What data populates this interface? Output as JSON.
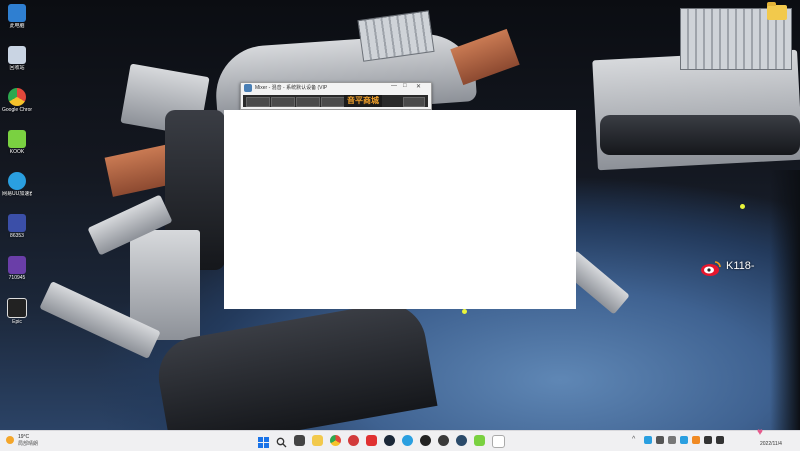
{
  "desktop": {
    "icons": [
      {
        "label": "此电脑",
        "icon": "computer-icon",
        "color": "#2f7fd1"
      },
      {
        "label": "回收站",
        "icon": "recycle-bin-icon",
        "color": "#c9d4e3"
      },
      {
        "label": "Google Chrome",
        "icon": "chrome-icon",
        "color": "#e2483b"
      },
      {
        "label": "KOOK",
        "icon": "kook-icon",
        "color": "#7ad141"
      },
      {
        "label": "网易UU加速器",
        "icon": "uu-accelerator-icon",
        "color": "#2a9fe0"
      },
      {
        "label": "86353",
        "icon": "app-icon",
        "color": "#3b4fa8"
      },
      {
        "label": "710945",
        "icon": "app-icon",
        "color": "#6a3ea8"
      },
      {
        "label": "Epic",
        "icon": "epic-games-icon",
        "color": "#222222"
      }
    ],
    "weibo_label": "K118-"
  },
  "mixer_window": {
    "title": "Mixer - 混音 - 系统默认设备 (VIP",
    "logo_text": "音平商城",
    "controls": [
      "—",
      "□",
      "✕"
    ]
  },
  "taskbar": {
    "weather_temp": "19°C",
    "weather_condition": "局部晴朗",
    "apps": [
      {
        "icon": "windows-start-icon",
        "color": "#1a73e8"
      },
      {
        "icon": "search-icon",
        "color": "#333333"
      },
      {
        "icon": "task-view-icon",
        "color": "#444444"
      },
      {
        "icon": "file-explorer-icon",
        "color": "#f2c94c"
      },
      {
        "icon": "chrome-icon",
        "color": "#e2483b"
      },
      {
        "icon": "app-icon",
        "color": "#d23b3b"
      },
      {
        "icon": "netease-music-icon",
        "color": "#e03131"
      },
      {
        "icon": "steam-icon",
        "color": "#1b2838"
      },
      {
        "icon": "app-icon",
        "color": "#2a9fe0"
      },
      {
        "icon": "qq-icon",
        "color": "#222222"
      },
      {
        "icon": "app-icon",
        "color": "#3a3a3a"
      },
      {
        "icon": "steam-icon",
        "color": "#2a4a6a"
      },
      {
        "icon": "kook-icon",
        "color": "#7ad141"
      },
      {
        "icon": "document-icon",
        "color": "#ffffff"
      }
    ],
    "tray": [
      {
        "icon": "chevron-up-icon",
        "color": "#555555"
      },
      {
        "icon": "app-icon",
        "color": "#2a9fe0"
      },
      {
        "icon": "app-icon",
        "color": "#555555"
      },
      {
        "icon": "app-icon",
        "color": "#777777"
      },
      {
        "icon": "app-icon",
        "color": "#2a9fe0"
      },
      {
        "icon": "app-icon",
        "color": "#f08a24"
      },
      {
        "icon": "language-icon",
        "color": "#333333"
      },
      {
        "icon": "volume-icon",
        "color": "#333333"
      }
    ],
    "clock_date": "2022/11/4"
  }
}
